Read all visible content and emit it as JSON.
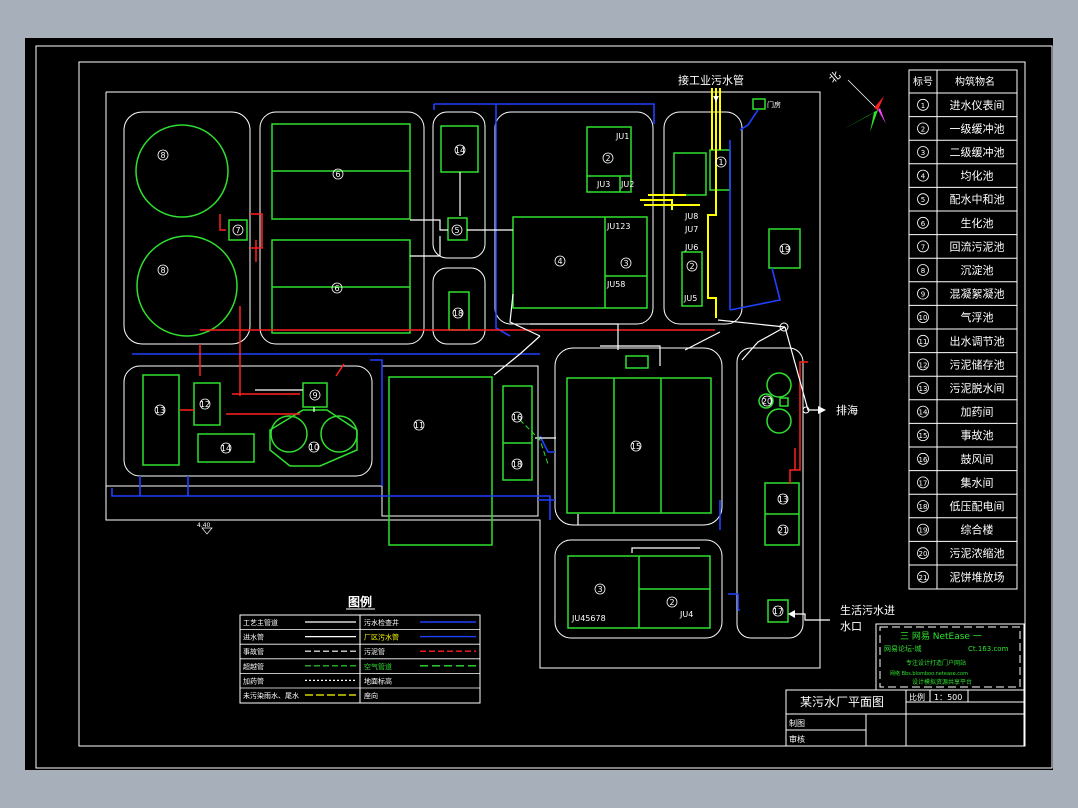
{
  "drawing_title": "某污水厂平面图",
  "scale_label": "比例",
  "scale_value": "1：500",
  "titleblock_row1": "制图",
  "titleblock_row2": "审核",
  "inlet_industrial": "接工业污水管",
  "inlet_domestic_line1": "生活污水进",
  "inlet_domestic_line2": "水口",
  "outlet": "排海",
  "gate_label": "门房",
  "north_label": "北",
  "legend": {
    "title": "图例",
    "left": [
      "工艺主管道",
      "进水管",
      "事故管",
      "超越管",
      "加药管",
      "未污染雨水、尾水"
    ],
    "right": [
      "污水检查井",
      "厂区污水管",
      "污泥管",
      "空气管道",
      "地面标高",
      "座向"
    ]
  },
  "building_table": {
    "headers": [
      "标号",
      "构筑物名"
    ],
    "rows": [
      [
        "1",
        "进水仪表间"
      ],
      [
        "2",
        "一级缓冲池"
      ],
      [
        "3",
        "二级缓冲池"
      ],
      [
        "4",
        "均化池"
      ],
      [
        "5",
        "配水中和池"
      ],
      [
        "6",
        "生化池"
      ],
      [
        "7",
        "回流污泥池"
      ],
      [
        "8",
        "沉淀池"
      ],
      [
        "9",
        "混凝絮凝池"
      ],
      [
        "10",
        "气浮池"
      ],
      [
        "11",
        "出水调节池"
      ],
      [
        "12",
        "污泥储存池"
      ],
      [
        "13",
        "污泥脱水间"
      ],
      [
        "14",
        "加药间"
      ],
      [
        "15",
        "事故池"
      ],
      [
        "16",
        "鼓风间"
      ],
      [
        "17",
        "集水间"
      ],
      [
        "18",
        "低压配电间"
      ],
      [
        "19",
        "综合楼"
      ],
      [
        "20",
        "污泥浓缩池"
      ],
      [
        "21",
        "泥饼堆放场"
      ]
    ]
  },
  "pump_labels": [
    "JU1",
    "JU2",
    "JU3",
    "JU123",
    "JU58",
    "JU5",
    "JU6",
    "JU7",
    "JU8",
    "JU4",
    "JU45678"
  ],
  "watermark": {
    "line1": "三 网易 NetEase 一",
    "line2a": "网易论坛-城",
    "line2b": "Ct.163.com",
    "line3": "专注设计打造门户网站",
    "line4": "网络 Bbs.blomboo.netease.com",
    "line5": "设计模拟资源共享平台"
  },
  "elevation_mark": "4.40"
}
